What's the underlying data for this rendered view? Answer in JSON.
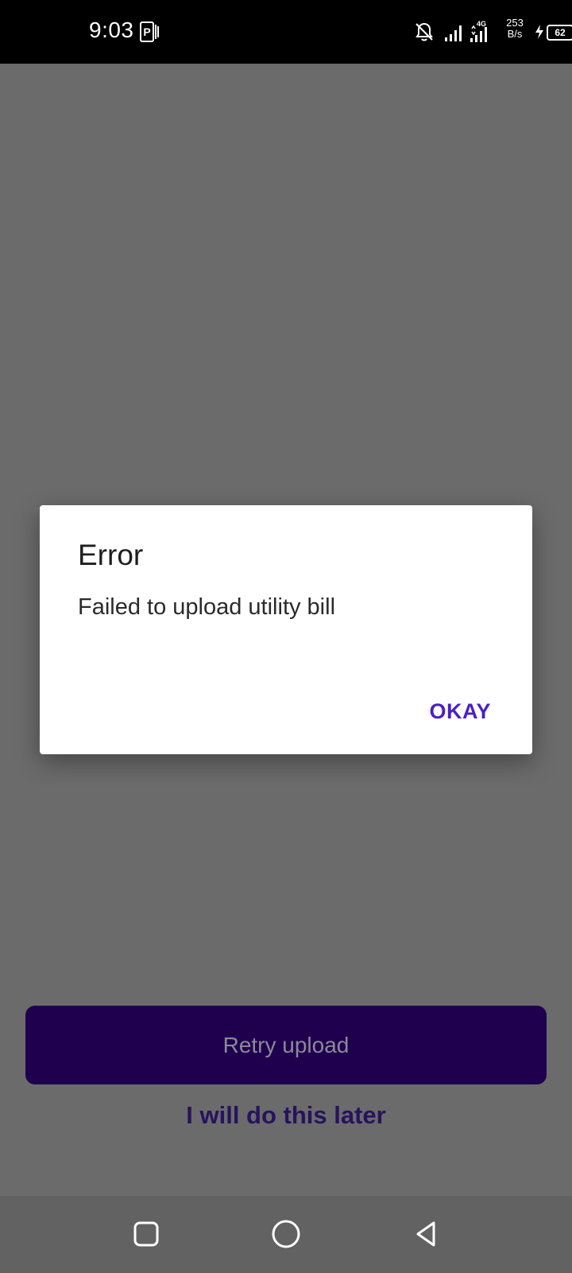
{
  "status_bar": {
    "time": "9:03",
    "net_speed": "253\nB/s",
    "battery_level": "62"
  },
  "dialog": {
    "title": "Error",
    "message": "Failed to upload utility bill",
    "ok_label": "OKAY"
  },
  "screen": {
    "primary_button_label": "Retry upload",
    "secondary_link_label": "I will do this later"
  },
  "icons": {
    "status_left": "p-app-icon",
    "muted": "notifications-off-icon",
    "signal_1": "signal-icon",
    "signal_2": "signal-4g-icon",
    "charging": "charging-icon",
    "battery": "battery-icon",
    "nav_recent": "square-icon",
    "nav_home": "circle-icon",
    "nav_back": "triangle-back-icon"
  },
  "colors": {
    "scrim": "#6b6b6b",
    "primary_button_bg": "#1f004f",
    "accent": "#4a1fc7",
    "nav_bar": "#626262"
  }
}
